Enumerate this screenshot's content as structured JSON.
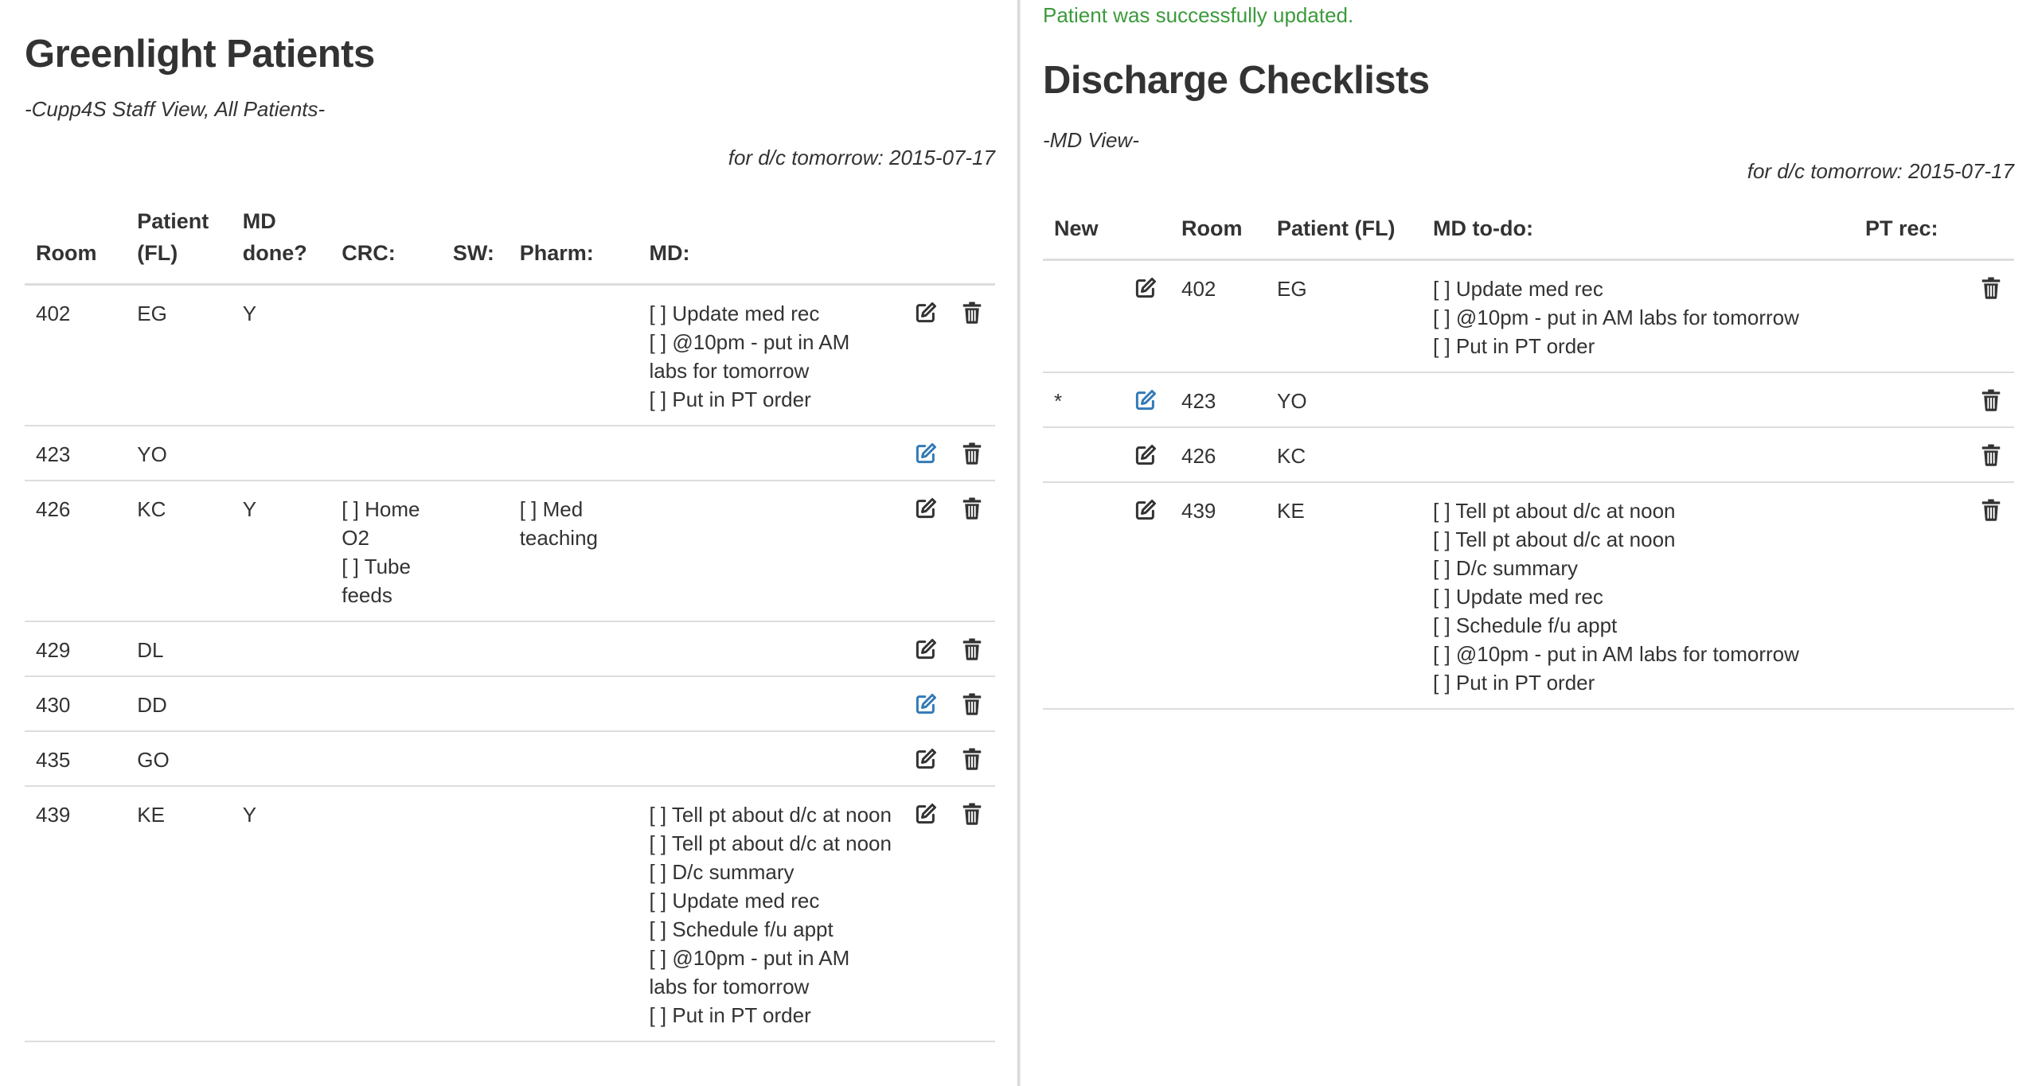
{
  "left": {
    "title": "Greenlight Patients",
    "subtitle": "-Cupp4S Staff View, All Patients-",
    "date_line": "for d/c tomorrow: 2015-07-17",
    "headers": {
      "room": "Room",
      "patient_l1": "Patient",
      "patient_l2": "(FL)",
      "md_done_l1": "MD",
      "md_done_l2": "done?",
      "crc": "CRC:",
      "sw": "SW:",
      "pharm": "Pharm:",
      "md": "MD:"
    },
    "rows": [
      {
        "room": "402",
        "patient": "EG",
        "md_done": "Y",
        "crc": [],
        "sw": [],
        "pharm": [],
        "md": [
          "[ ] Update med rec",
          "[ ] @10pm - put in AM labs for tomorrow",
          "[ ] Put in PT order"
        ],
        "edit_active": false
      },
      {
        "room": "423",
        "patient": "YO",
        "md_done": "",
        "crc": [],
        "sw": [],
        "pharm": [],
        "md": [],
        "edit_active": true
      },
      {
        "room": "426",
        "patient": "KC",
        "md_done": "Y",
        "crc": [
          "[ ] Home O2",
          "[ ] Tube feeds"
        ],
        "sw": [],
        "pharm": [
          "[ ] Med teaching"
        ],
        "md": [],
        "edit_active": false
      },
      {
        "room": "429",
        "patient": "DL",
        "md_done": "",
        "crc": [],
        "sw": [],
        "pharm": [],
        "md": [],
        "edit_active": false
      },
      {
        "room": "430",
        "patient": "DD",
        "md_done": "",
        "crc": [],
        "sw": [],
        "pharm": [],
        "md": [],
        "edit_active": true
      },
      {
        "room": "435",
        "patient": "GO",
        "md_done": "",
        "crc": [],
        "sw": [],
        "pharm": [],
        "md": [],
        "edit_active": false
      },
      {
        "room": "439",
        "patient": "KE",
        "md_done": "Y",
        "crc": [],
        "sw": [],
        "pharm": [],
        "md": [
          "[ ] Tell pt about d/c at noon",
          "[ ] Tell pt about d/c at noon",
          "[ ] D/c summary",
          "[ ] Update med rec",
          "[ ] Schedule f/u appt",
          "[ ] @10pm - put in AM labs for tomorrow",
          "[ ] Put in PT order"
        ],
        "edit_active": false
      }
    ]
  },
  "right": {
    "flash": "Patient was successfully updated.",
    "title": "Discharge Checklists",
    "subtitle": "-MD View-",
    "date_line": "for d/c tomorrow: 2015-07-17",
    "headers": {
      "new": "New",
      "room": "Room",
      "patient": "Patient (FL)",
      "md_todo": "MD to-do:",
      "pt_rec": "PT rec:"
    },
    "rows": [
      {
        "new": "",
        "room": "402",
        "patient": "EG",
        "md_todo": [
          "[ ] Update med rec",
          "[ ] @10pm - put in AM labs for tomorrow",
          "[ ] Put in PT order"
        ],
        "pt_rec": "",
        "edit_active": false
      },
      {
        "new": "*",
        "room": "423",
        "patient": "YO",
        "md_todo": [],
        "pt_rec": "",
        "edit_active": true
      },
      {
        "new": "",
        "room": "426",
        "patient": "KC",
        "md_todo": [],
        "pt_rec": "",
        "edit_active": false
      },
      {
        "new": "",
        "room": "439",
        "patient": "KE",
        "md_todo": [
          "[ ] Tell pt about d/c at noon",
          "[ ] Tell pt about d/c at noon",
          "[ ] D/c summary",
          "[ ] Update med rec",
          "[ ] Schedule f/u appt",
          "[ ] @10pm - put in AM labs for tomorrow",
          "[ ] Put in PT order"
        ],
        "pt_rec": "",
        "edit_active": false
      }
    ]
  },
  "colors": {
    "edit_icon_default": "#333333",
    "edit_icon_active": "#337ab7",
    "flash_success": "#3c9a3c"
  },
  "icons": {
    "edit": "edit-icon",
    "delete": "trash-icon"
  }
}
